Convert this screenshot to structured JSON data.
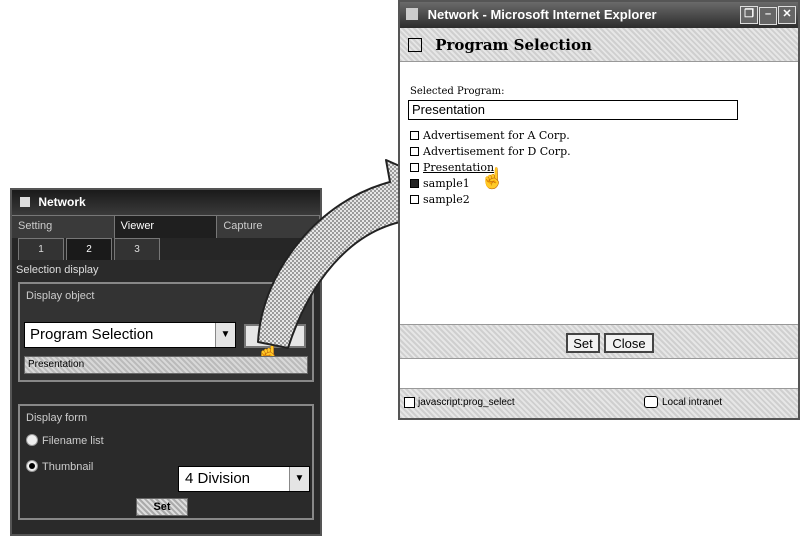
{
  "left_panel": {
    "title": "Network",
    "tabs": [
      "Setting",
      "Viewer",
      "Capture"
    ],
    "subtabs": [
      "1",
      "2",
      "3"
    ],
    "section_title": "Selection display",
    "display_object": {
      "label": "Display object",
      "select_value": "Program Selection",
      "select_button": "Select",
      "selected_program": "Presentation"
    },
    "display_form": {
      "label": "Display form",
      "options": [
        "Filename list",
        "Thumbnail"
      ],
      "selected_option": "Thumbnail",
      "division_value": "4 Division",
      "set_button": "Set"
    }
  },
  "ie_window": {
    "title": "Network - Microsoft Internet Explorer",
    "header": "Program Selection",
    "selected_label": "Selected Program:",
    "selected_value": "Presentation",
    "programs": [
      "Advertisement for A Corp.",
      "Advertisement for D Corp.",
      "Presentation",
      "sample1",
      "sample2"
    ],
    "buttons": {
      "set": "Set",
      "close": "Close"
    },
    "status_text": "javascript:prog_select",
    "zone_text": "Local intranet"
  }
}
